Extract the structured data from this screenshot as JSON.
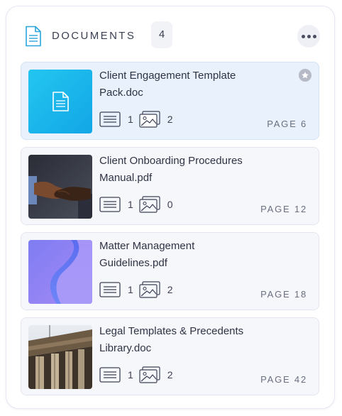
{
  "header": {
    "icon": "document-icon",
    "title": "DOCUMENTS",
    "count": "4",
    "more_icon": "more-horizontal-icon"
  },
  "colors": {
    "accent": "#1fb8ee",
    "selected_bg": "#e8f1fc",
    "card_bg": "#f6f7fb"
  },
  "documents": [
    {
      "name_line1": "Client Engagement Template",
      "name_line2": "Pack.doc",
      "thumbnail": "doc-file-icon",
      "text_blocks": "1",
      "images": "2",
      "page": "PAGE 6",
      "selected": true,
      "starred": true
    },
    {
      "name_line1": "Client Onboarding Procedures",
      "name_line2": "Manual.pdf",
      "thumbnail": "handshake-photo",
      "text_blocks": "1",
      "images": "0",
      "page": "PAGE 12"
    },
    {
      "name_line1": "Matter Management",
      "name_line2": "Guidelines.pdf",
      "thumbnail": "purple-abstract-photo",
      "text_blocks": "1",
      "images": "2",
      "page": "PAGE 18"
    },
    {
      "name_line1": "Legal Templates & Precedents",
      "name_line2": "Library.doc",
      "thumbnail": "courthouse-columns-photo",
      "text_blocks": "1",
      "images": "2",
      "page": "PAGE 42"
    }
  ]
}
